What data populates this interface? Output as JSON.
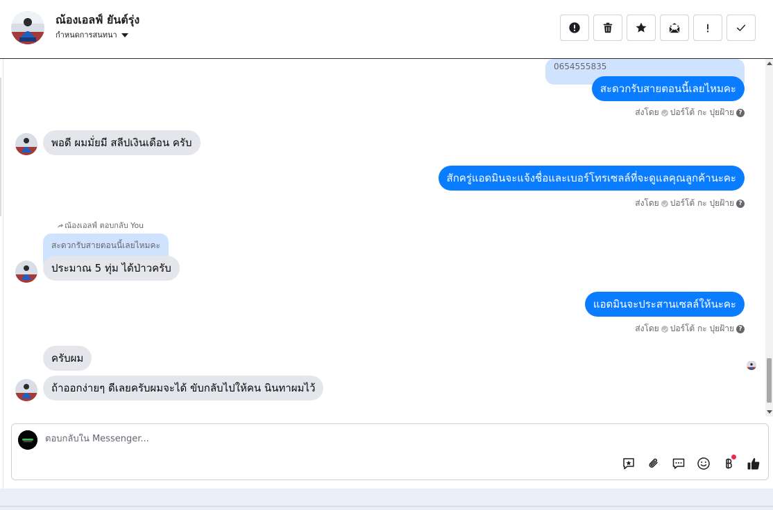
{
  "header": {
    "contact_name": "ณ้องเอลฟ์ ยันต์รุ่ง",
    "subtitle": "กำหนดการสนทนา",
    "actions": [
      {
        "name": "report-button",
        "icon": "alert-circle-icon"
      },
      {
        "name": "delete-button",
        "icon": "trash-icon"
      },
      {
        "name": "star-button",
        "icon": "star-icon"
      },
      {
        "name": "mark-unread-button",
        "icon": "envelope-open-icon"
      },
      {
        "name": "flag-button",
        "icon": "exclamation-icon"
      },
      {
        "name": "done-button",
        "icon": "checkmark-icon"
      }
    ]
  },
  "messages": {
    "quoted_phone": "0654555835",
    "m1": "สะดวกรับสายตอนนี้เลยไหมคะ",
    "m1_sent_prefix": "ส่งโดย",
    "m1_sent_name": "ปอร์โต้ กะ ปุยฝ้าย",
    "m2": "พอดี ผมมั่ยมี สลีปเงินเดือน ครับ",
    "m3": "สักครู่แอดมินจะแจ้งชื่อและเบอร์โทรเซลล์ที่จะดูแลคุณลูกค้านะคะ",
    "m3_sent_prefix": "ส่งโดย",
    "m3_sent_name": "ปอร์โต้ กะ ปุยฝ้าย",
    "reply_note": "ณ้องเอลฟ์ ตอบกลับ You",
    "quoted_reply": "สะดวกรับสายตอนนี้เลยไหมคะ",
    "m4": "ประมาณ 5 ทุ่ม ได้ป่าวครับ",
    "m5": "แอดมินจะประสานเซลล์ให้นะคะ",
    "m5_sent_prefix": "ส่งโดย",
    "m5_sent_name": "ปอร์โต้ กะ ปุยฝ้าย",
    "m6": "ครับผม",
    "m7": "ถ้าออกง่ายๆ ดีเลยครับผมจะได้ ขับกลับไปให้คน นินทาผมไว้"
  },
  "composer": {
    "placeholder": "ตอบกลับใน Messenger...",
    "tools": [
      "saved-reply-icon",
      "attachment-icon",
      "chat-bubble-icon",
      "emoji-icon",
      "baht-payment-icon",
      "like-icon"
    ]
  },
  "colors": {
    "outgoing_bubble": "#0a7cff",
    "incoming_bubble": "#e4e6eb",
    "quoted_bubble": "#cfe3ff",
    "notification_dot": "#f02849"
  }
}
